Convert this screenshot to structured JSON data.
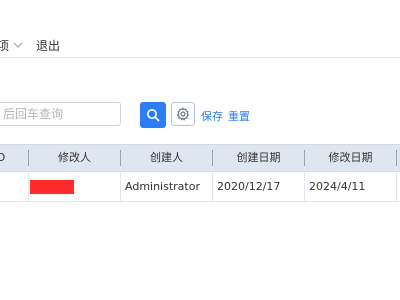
{
  "nav": {
    "menu_label": "项",
    "logout_label": "退出"
  },
  "toolbar": {
    "search_placeholder": "后回车查询",
    "save_label": "保存",
    "reset_label": "重置"
  },
  "table": {
    "columns": [
      "O",
      "修改人",
      "创建人",
      "创建日期",
      "修改日期"
    ],
    "rows": [
      {
        "modified_by_redacted": true,
        "created_by": "Administrator",
        "created_date": "2020/12/17",
        "modified_date": "2024/4/11"
      }
    ]
  },
  "colors": {
    "accent": "#2d7df6",
    "header_bg": "#dfe6ef",
    "redaction": "#ff2a2a"
  },
  "icons": {
    "search_button": "search-icon",
    "settings_button": "gear-icon",
    "nav_dropdown": "chevron-down-icon"
  }
}
